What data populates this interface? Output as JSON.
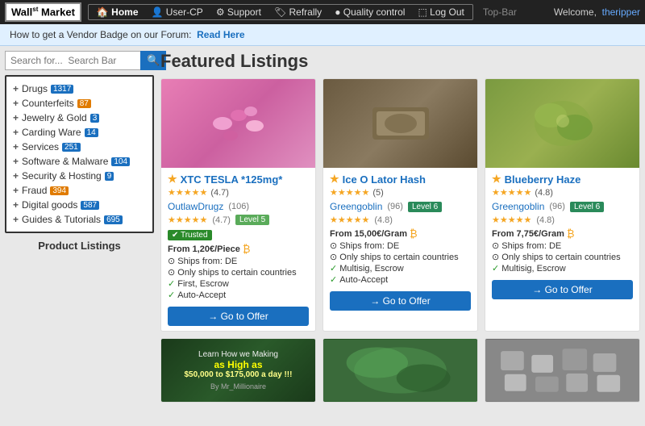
{
  "topbar": {
    "logo": "Wall",
    "logo_sup": "st",
    "logo_rest": " Market",
    "label": "Top-Bar",
    "welcome_prefix": "Welcome,",
    "username": "theripper",
    "nav": [
      {
        "label": "Home",
        "icon": "🏠",
        "active": true
      },
      {
        "label": "User-CP",
        "icon": "👤"
      },
      {
        "label": "Support",
        "icon": "⚙"
      },
      {
        "label": "Refrally",
        "icon": "🏷"
      },
      {
        "label": "Quality control",
        "icon": "●"
      },
      {
        "label": "Log Out",
        "icon": "⬚"
      }
    ]
  },
  "banner": {
    "text": "How to get a Vendor Badge on our Forum:",
    "link_text": "Read Here"
  },
  "search": {
    "placeholder": "Search for...",
    "placeholder_label": "Search Bar",
    "button_icon": "🔍"
  },
  "categories": [
    {
      "label": "Drugs",
      "count": "1317",
      "badge": "blue"
    },
    {
      "label": "Counterfeits",
      "count": "87",
      "badge": "orange"
    },
    {
      "label": "Jewelry & Gold",
      "count": "3",
      "badge": "blue"
    },
    {
      "label": "Carding Ware",
      "count": "14",
      "badge": "blue"
    },
    {
      "label": "Services",
      "count": "251",
      "badge": "blue"
    },
    {
      "label": "Software & Malware",
      "count": "104",
      "badge": "blue"
    },
    {
      "label": "Security & Hosting",
      "count": "9",
      "badge": "blue"
    },
    {
      "label": "Fraud",
      "count": "394",
      "badge": "orange"
    },
    {
      "label": "Digital goods",
      "count": "587",
      "badge": "blue"
    },
    {
      "label": "Guides & Tutorials",
      "count": "695",
      "badge": "blue"
    }
  ],
  "product_listings_label": "Product Listings",
  "featured_title": "Featured Listings",
  "listings": [
    {
      "title": "XTC TESLA *125mg*",
      "stars": 4.7,
      "stars_count": 4.7,
      "seller": "OutlawDrugz",
      "seller_reviews": 106,
      "seller_level": "Level 5",
      "trusted": true,
      "price": "1,20€/Piece",
      "ships_from": "DE",
      "only_certain": true,
      "escrow": "First, Escrow",
      "auto_accept": true,
      "multisig": false,
      "btn_label": "→ Go to Offer",
      "img_color": "#e87eb5"
    },
    {
      "title": "Ice O Lator Hash",
      "stars": 4.8,
      "stars_count": 5,
      "seller": "Greengoblin",
      "seller_reviews": 96,
      "seller_level": "Level 6",
      "trusted": false,
      "price": "15,00€/Gram",
      "ships_from": "DE",
      "only_certain": true,
      "escrow": "Multisig, Escrow",
      "auto_accept": true,
      "multisig": true,
      "btn_label": "→ Go to Offer",
      "img_color": "#7a6a50"
    },
    {
      "title": "Blueberry Haze",
      "stars": 4.8,
      "stars_count": 4.8,
      "seller": "Greengoblin",
      "seller_reviews": 96,
      "seller_level": "Level 6",
      "trusted": false,
      "price": "7,75€/Gram",
      "ships_from": "DE",
      "only_certain": true,
      "escrow": "Multisig, Escrow",
      "auto_accept": false,
      "multisig": true,
      "btn_label": "→ Go to Offer",
      "img_color": "#9aad62"
    }
  ],
  "thumbnails": [
    {
      "type": "banner",
      "big": "Learn How we Making",
      "highlight": "as High as",
      "money": "$50,000 to $175,000 a day !!!",
      "sub": "By Mr_Millionaire"
    },
    {
      "type": "green"
    },
    {
      "type": "gray"
    }
  ]
}
